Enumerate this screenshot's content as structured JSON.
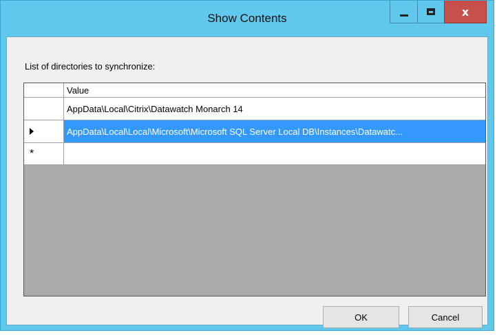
{
  "window": {
    "title": "Show Contents",
    "controls": {
      "minimize_icon": "minimize-icon",
      "maximize_icon": "maximize-icon",
      "close_icon": "close-icon",
      "close_glyph": "x",
      "close_color": "#c7504b"
    }
  },
  "caption": "List of directories to synchronize:",
  "grid": {
    "column_header": "Value",
    "rows": [
      {
        "marker": "",
        "value": "AppData\\Local\\Citrix\\Datawatch Monarch 14",
        "selected": false
      },
      {
        "marker": "current-row-arrow",
        "value": "AppData\\Local\\Local\\Microsoft\\Microsoft SQL Server Local DB\\Instances\\Datawatc...",
        "selected": true
      },
      {
        "marker": "*",
        "value": "",
        "selected": false
      }
    ],
    "selection_color": "#3399ff"
  },
  "buttons": {
    "ok": "OK",
    "cancel": "Cancel"
  }
}
